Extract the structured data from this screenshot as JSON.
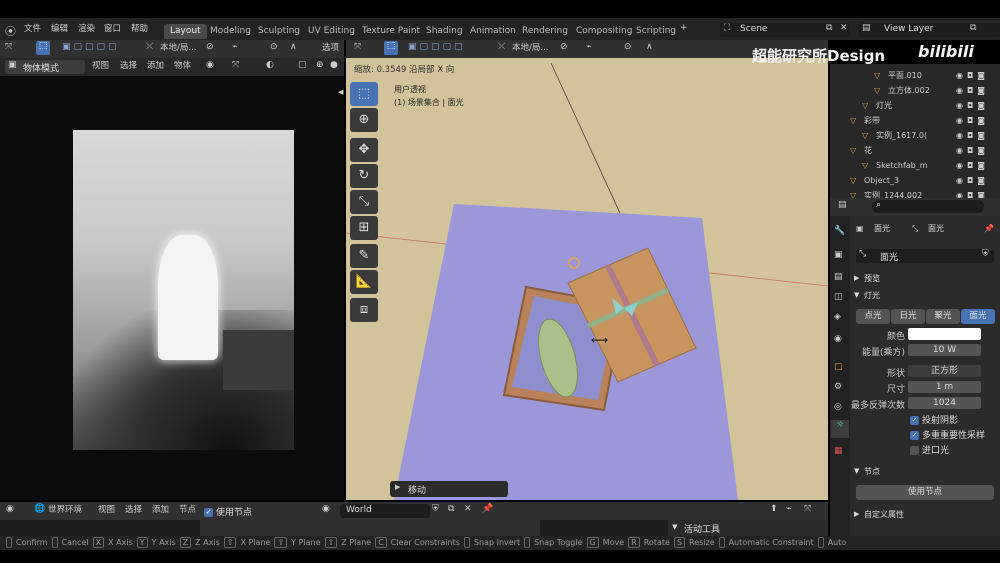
{
  "menu": {
    "file": "文件",
    "edit": "编辑",
    "render": "渲染",
    "window": "窗口",
    "help": "帮助"
  },
  "workspaces": [
    "Layout",
    "Modeling",
    "Sculpting",
    "UV Editing",
    "Texture Paint",
    "Shading",
    "Animation",
    "Rendering",
    "Compositing",
    "Scripting"
  ],
  "active_workspace": "Layout",
  "scene": {
    "name": "Scene",
    "view_layer": "View Layer"
  },
  "left_header": {
    "mode": "物体模式",
    "view": "视图",
    "select": "选择",
    "add": "添加",
    "object": "物体",
    "transform": "本地/局...",
    "options": "选项"
  },
  "viewport": {
    "transform": "本地/局...",
    "scale_status": "缩放: 0.3549 沿局部 X 向",
    "view_name": "用户透视",
    "collection": "(1) 场景集合 | 面光",
    "operator": "移动"
  },
  "watermark": {
    "text": "超能研究所Design",
    "logo": "bilibili"
  },
  "outliner": [
    {
      "name": "平面.010",
      "indent": 3
    },
    {
      "name": "立方体.002",
      "indent": 3
    },
    {
      "name": "灯光",
      "indent": 2
    },
    {
      "name": "彩带",
      "indent": 1
    },
    {
      "name": "实例_1617.0(",
      "indent": 2
    },
    {
      "name": "花",
      "indent": 1
    },
    {
      "name": "Sketchfab_m",
      "indent": 2
    },
    {
      "name": "Object_3",
      "indent": 1
    },
    {
      "name": "实例_1244.002",
      "indent": 1
    }
  ],
  "properties": {
    "object_name": "面光",
    "data_name": "面光",
    "light_data": "面光",
    "preview": "预览",
    "light_section": "灯光",
    "light_types": [
      "点光",
      "日光",
      "聚光",
      "面光"
    ],
    "active_type": "面光",
    "color_label": "颜色",
    "power_label": "能量(乘方)",
    "power": "10 W",
    "shape_label": "形状",
    "shape": "正方形",
    "size_label": "尺寸",
    "size": "1 m",
    "bounces_label": "最多反弹次数",
    "bounces": "1024",
    "cast_shadow": "投射阴影",
    "mis": "多重重要性采样",
    "portal": "进口光",
    "nodes_section": "节点",
    "use_nodes_btn": "使用节点",
    "custom_props": "自定义属性",
    "light_color": "#ffffff"
  },
  "bottom_header": {
    "env": "世界环境",
    "view": "视图",
    "select": "选择",
    "add": "添加",
    "node": "节点",
    "use_nodes": "使用节点",
    "world": "World"
  },
  "active_tool": "活动工具",
  "status": [
    {
      "key": "",
      "label": "Confirm"
    },
    {
      "key": "",
      "label": "Cancel"
    },
    {
      "key": "X",
      "label": "X Axis"
    },
    {
      "key": "Y",
      "label": "Y Axis"
    },
    {
      "key": "Z",
      "label": "Z Axis"
    },
    {
      "key": "⇧",
      "label": "X Plane"
    },
    {
      "key": "⇧",
      "label": "Y Plane"
    },
    {
      "key": "⇧",
      "label": "Z Plane"
    },
    {
      "key": "C",
      "label": "Clear Constraints"
    },
    {
      "key": "",
      "label": "Snap Invert"
    },
    {
      "key": "",
      "label": "Snap Toggle"
    },
    {
      "key": "G",
      "label": "Move"
    },
    {
      "key": "R",
      "label": "Rotate"
    },
    {
      "key": "S",
      "label": "Resize"
    },
    {
      "key": "",
      "label": "Automatic Constraint"
    },
    {
      "key": "",
      "label": "Auto"
    }
  ],
  "colors": {
    "accent": "#4772b3",
    "viewport_bg": "#d2c39b",
    "plane": "#9b97d9",
    "box": "#c48a5a",
    "header": "#303030"
  }
}
